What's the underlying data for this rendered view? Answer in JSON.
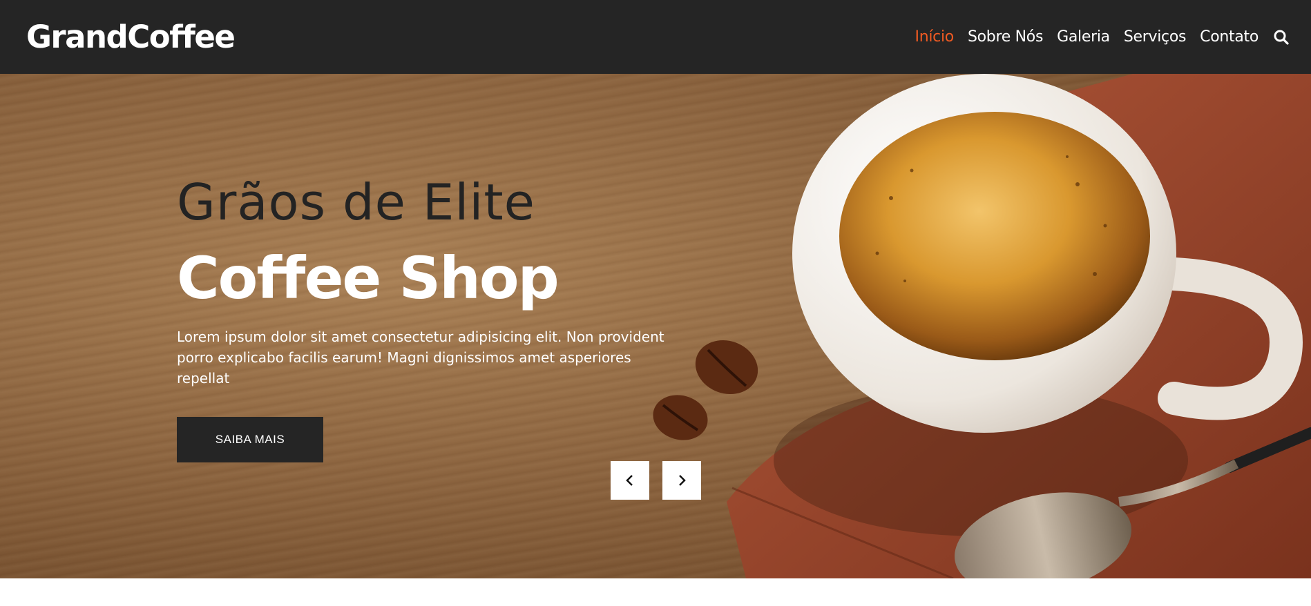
{
  "header": {
    "logo": "GrandCoffee",
    "nav": [
      {
        "label": "Início",
        "active": true
      },
      {
        "label": "Sobre Nós",
        "active": false
      },
      {
        "label": "Galeria",
        "active": false
      },
      {
        "label": "Serviços",
        "active": false
      },
      {
        "label": "Contato",
        "active": false
      }
    ],
    "search_icon": "search-icon"
  },
  "hero": {
    "subtitle": "Grãos de Elite",
    "title": "Coffee Shop",
    "text": "Lorem ipsum dolor sit amet consectetur adipisicing elit. Non provident porro explicabo facilis earum! Magni dignissimos amet asperiores repellat",
    "button_label": "SAIBA MAIS",
    "prev_icon": "chevron-left-icon",
    "next_icon": "chevron-right-icon"
  },
  "colors": {
    "navbar_bg": "#252525",
    "accent": "#f05a22",
    "button_bg": "#252525"
  }
}
